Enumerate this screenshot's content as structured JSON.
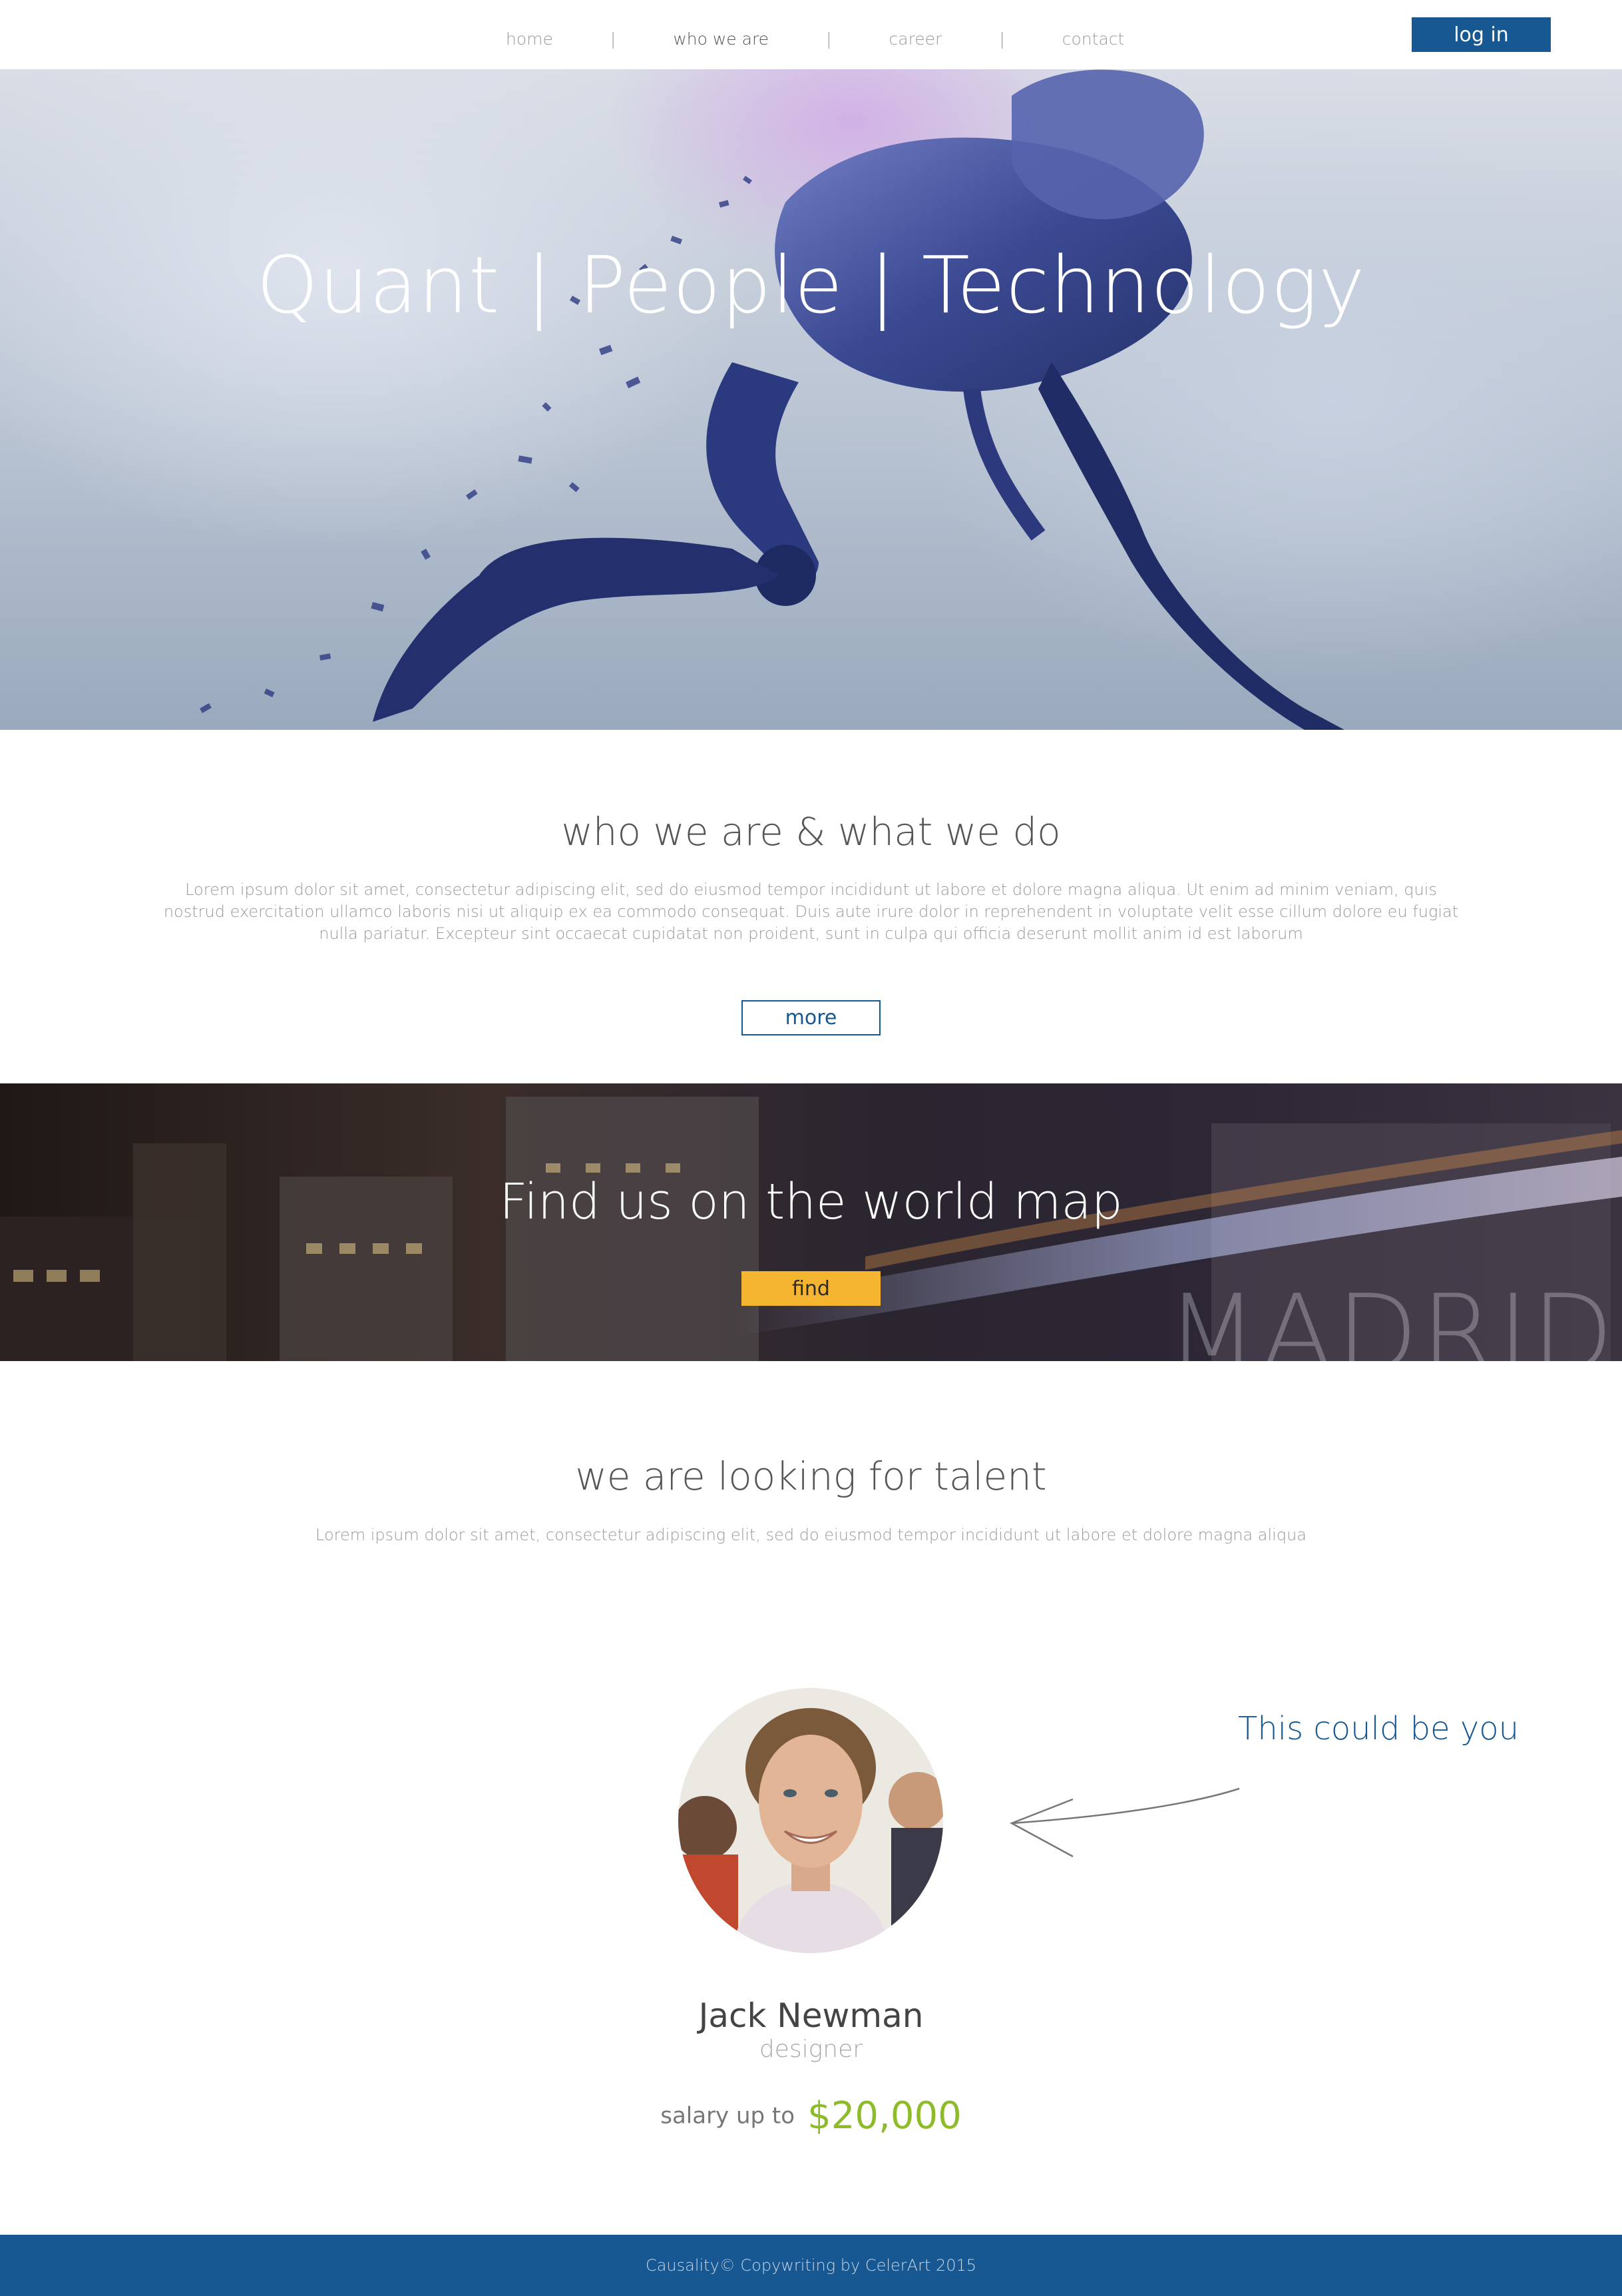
{
  "nav": {
    "items": [
      {
        "label": "home"
      },
      {
        "label": "who we are"
      },
      {
        "label": "career"
      },
      {
        "label": "contact"
      }
    ],
    "separator": "|",
    "login_label": "log in"
  },
  "hero": {
    "title": "Quant | People | Technology"
  },
  "about": {
    "title": "who we are & what we do",
    "text": "Lorem ipsum dolor sit amet, consectetur adipiscing elit, sed do eiusmod tempor incididunt ut labore et dolore magna aliqua. Ut enim ad minim veniam, quis nostrud exercitation ullamco laboris nisi ut aliquip ex ea commodo consequat. Duis aute irure dolor in reprehendent in voluptate velit esse cillum dolore eu fugiat nulla pariatur. Excepteur sint occaecat cupidatat non proident, sunt in culpa qui officia deserunt mollit anim id est laborum",
    "more_label": "more"
  },
  "map": {
    "title": "Find us on the world map",
    "find_label": "find",
    "city": "MADRID"
  },
  "talent": {
    "title": "we are looking for talent",
    "text": "Lorem ipsum dolor sit amet, consectetur adipiscing elit, sed do eiusmod tempor incididunt ut labore et dolore magna aliqua",
    "callout": "This could be you",
    "person": {
      "name": "Jack Newman",
      "role": "designer",
      "salary_label": "salary up to",
      "salary_value": "$20,000"
    }
  },
  "footer": {
    "text": "Causality© Copywriting by CelerArt 2015"
  },
  "colors": {
    "brand_blue": "#175792",
    "accent_yellow": "#f5b531",
    "salary_green": "#8dbb2a"
  }
}
